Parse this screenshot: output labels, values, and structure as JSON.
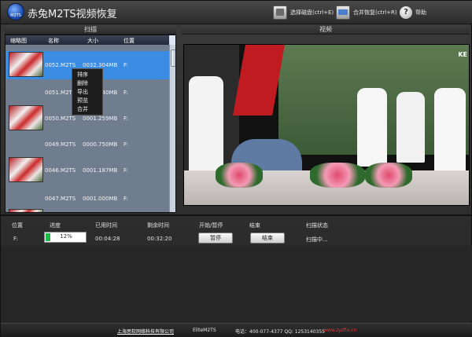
{
  "app": {
    "logo_text": "M2TS",
    "title": "赤兔M2TS视频恢复"
  },
  "toolbar": {
    "select_disk": "选择磁盘(ctrl+E)",
    "merge_recover": "合并恢复(ctrl+R)",
    "help": "帮助",
    "help_glyph": "?"
  },
  "panels": {
    "scan": "扫描",
    "video": "视频"
  },
  "scan_list": {
    "headers": {
      "thumb": "缩略图",
      "name": "名称",
      "size": "大小",
      "location": "位置"
    },
    "rows": [
      {
        "name": "0052.M2TS",
        "size": "0032.304MB",
        "location": "F:",
        "selected": true
      },
      {
        "name": "0051.M2TS",
        "size": "0000.840MB",
        "location": "F:"
      },
      {
        "name": "0050.M2TS",
        "size": "0001.259MB",
        "location": "F:"
      },
      {
        "name": "0049.M2TS",
        "size": "0000.750MB",
        "location": "F:"
      },
      {
        "name": "0046.M2TS",
        "size": "0001.187MB",
        "location": "F:"
      },
      {
        "name": "0047.M2TS",
        "size": "0001.000MB",
        "location": "F:"
      }
    ]
  },
  "context_menu": [
    "排序",
    "删除",
    "导出",
    "预览",
    "合并"
  ],
  "task": {
    "headers": {
      "location": "位置",
      "progress": "进度",
      "elapsed": "已用时间",
      "remaining": "剩余时间",
      "start_pause": "开始/暂停",
      "end": "结束",
      "status": "扫描状态"
    },
    "location": "F:",
    "progress_pct": 12,
    "progress_label": "12%",
    "elapsed": "00:04:28",
    "remaining": "00:32:20",
    "pause_btn": "暂停",
    "end_btn": "结束",
    "status": "扫描中..."
  },
  "video_tag": "KE",
  "footer": {
    "company": "上海思软网络科技有限公司",
    "brand": "EliteM2TS",
    "contact": "电话：400-077-4377 QQ: 1253140355",
    "site": "www.zyzfix.cn"
  },
  "colors": {
    "selected_row": "#3b8de4",
    "progress_fill": "#21b84a",
    "footer_link": "#e33b3b"
  }
}
